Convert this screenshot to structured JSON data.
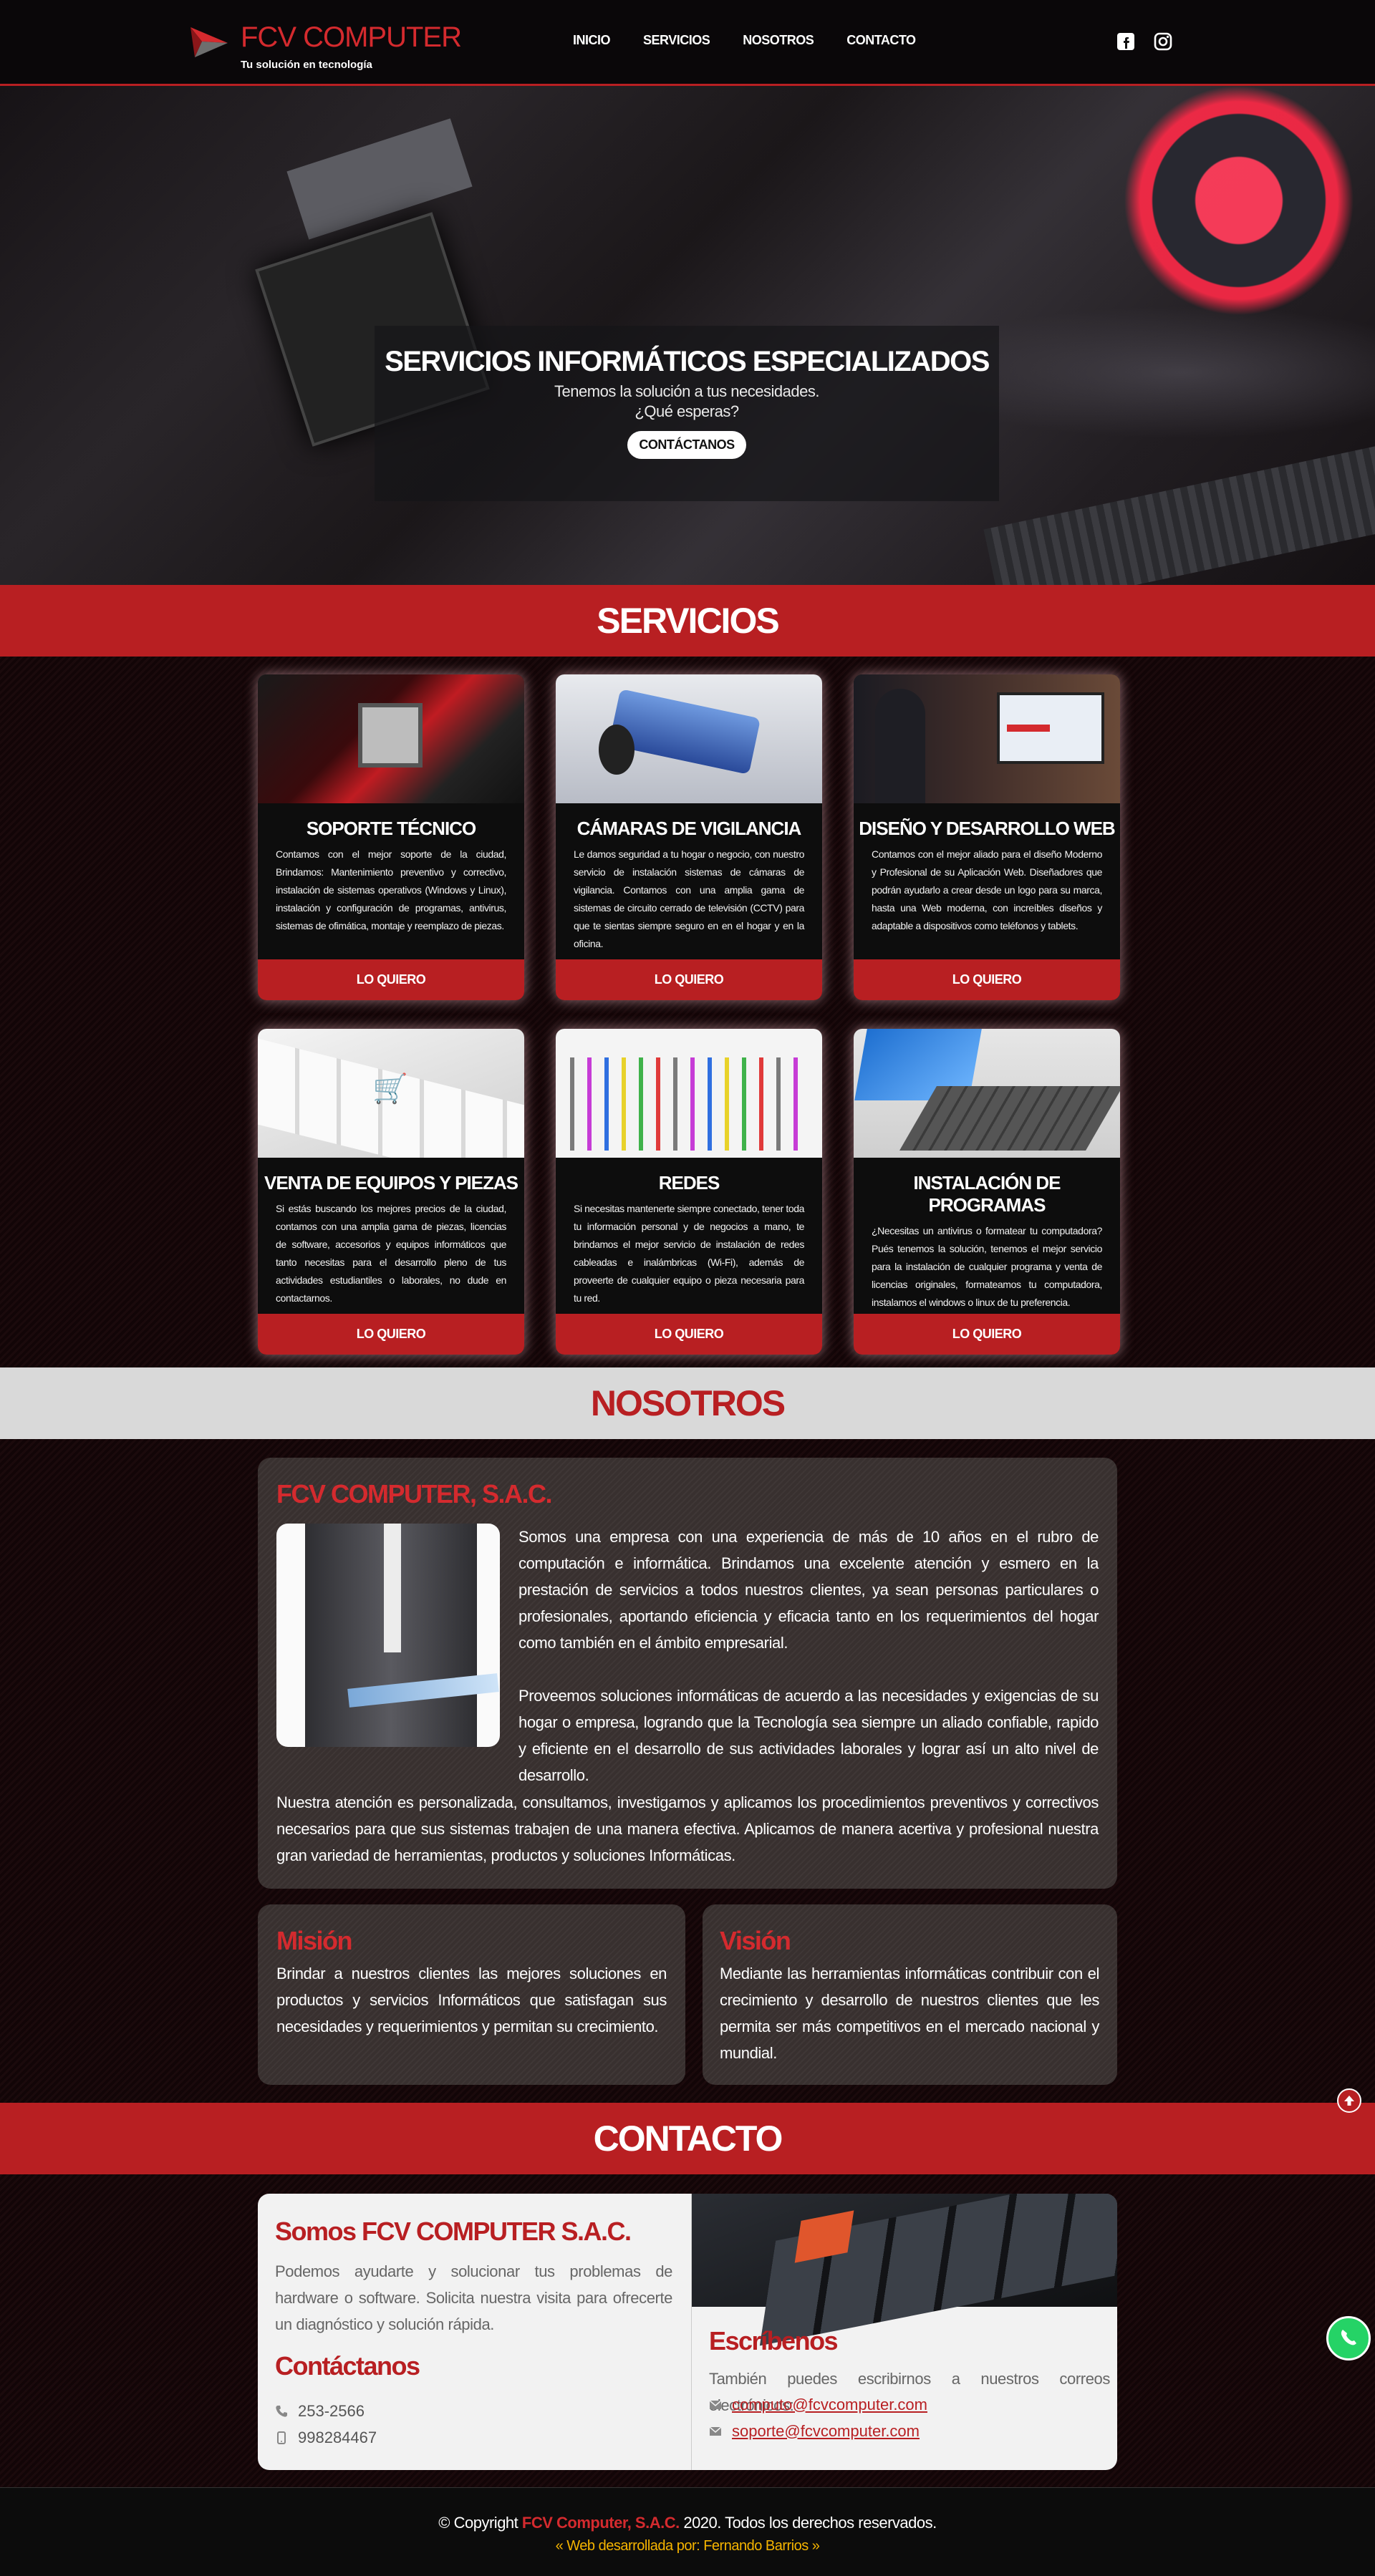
{
  "header": {
    "brand": "FCV COMPUTER",
    "tagline": "Tu solución en tecnología",
    "nav": [
      "INICIO",
      "SERVICIOS",
      "NOSOTROS",
      "CONTACTO"
    ],
    "social_icons": [
      "facebook-icon",
      "instagram-icon"
    ]
  },
  "hero": {
    "title": "SERVICIOS INFORMÁTICOS ESPECIALIZADOS",
    "line1": "Tenemos la solución a tus necesidades.",
    "line2": "¿Qué esperas?",
    "cta": "CONTÁCTANOS"
  },
  "servicios": {
    "heading": "SERVICIOS",
    "cards": [
      {
        "title": "SOPORTE TÉCNICO",
        "text": "Contamos con el mejor soporte de la ciudad, Brindamos: Mantenimiento preventivo y correctivo, instalación de sistemas operativos (Windows y Linux), instalación y configuración de programas, antivirus, sistemas de ofimática, montaje y reemplazo de piezas.",
        "button": "LO QUIERO"
      },
      {
        "title": "CÁMARAS DE VIGILANCIA",
        "text": "Le damos seguridad a tu hogar o negocio, con nuestro servicio de instalación sistemas de cámaras de vigilancia. Contamos con una amplia gama de sistemas de circuito cerrado de televisión (CCTV) para que te sientas siempre seguro en en el hogar y en la oficina.",
        "button": "LO QUIERO"
      },
      {
        "title": "DISEÑO Y DESARROLLO WEB",
        "text": "Contamos con el mejor aliado para el diseño Moderno y Profesional de su Aplicación Web. Diseñadores que podrán ayudarlo a crear desde un logo para su marca, hasta una Web moderna, con increíbles diseños y adaptable a dispositivos como teléfonos y tablets.",
        "button": "LO QUIERO"
      },
      {
        "title": "VENTA DE EQUIPOS Y PIEZAS",
        "text": "Si estás buscando los mejores precios de la ciudad, contamos con una amplia gama de piezas, licencias de software, accesorios y equipos informáticos que tanto necesitas para el desarrollo pleno de tus actividades estudiantiles o laborales, no dude en contactarnos.",
        "button": "LO QUIERO"
      },
      {
        "title": "REDES",
        "text": "Si necesitas mantenerte siempre conectado, tener toda tu información personal y de negocios a mano, te brindamos el mejor servicio de instalación de redes cableadas e inalámbricas (Wi-Fi), además de proveerte de cualquier equipo o pieza necesaria para tu red.",
        "button": "LO QUIERO"
      },
      {
        "title": "INSTALACIÓN DE PROGRAMAS",
        "text": "¿Necesitas un antivirus o formatear tu computadora? Pués tenemos la solución, tenemos el mejor servicio para la instalación de cualquier programa y venta de licencias originales, formateamos tu computadora, instalamos el windows o linux de tu preferencia.",
        "button": "LO QUIERO"
      }
    ]
  },
  "nosotros": {
    "heading": "NOSOTROS",
    "company": "FCV COMPUTER, S.A.C.",
    "p1": "Somos una empresa con una experiencia de más de 10 años en el rubro de computación e informática. Brindamos una excelente atención y esmero en la prestación de servicios a todos nuestros clientes, ya sean personas particulares o profesionales, aportando eficiencia y eficacia tanto en los requerimientos del hogar como también en el ámbito empresarial.",
    "p2": "Proveemos soluciones informáticas de acuerdo a las necesidades y exigencias de su hogar o empresa, logrando que la Tecnología sea siempre un aliado confiable, rapido y eficiente en el desarrollo de sus actividades laborales y lograr así un alto nivel de desarrollo.",
    "p3": "Nuestra atención es personalizada, consultamos, investigamos y aplicamos los procedimientos preventivos y correctivos necesarios para que sus sistemas trabajen de una manera efectiva. Aplicamos de manera acertiva y profesional nuestra gran variedad de herramientas, productos y soluciones Informáticas.",
    "mision_title": "Misión",
    "mision": "Brindar a nuestros clientes las mejores soluciones en productos y servicios Informáticos que satisfagan sus necesidades y requerimientos y permitan su crecimiento.",
    "vision_title": "Visión",
    "vision": "Mediante las herramientas informáticas contribuir con el crecimiento y desarrollo de nuestros clientes que les permita ser más competitivos en el mercado nacional y mundial."
  },
  "contacto": {
    "heading": "CONTACTO",
    "left_title": "Somos FCV COMPUTER S.A.C.",
    "left_text": "Podemos ayudarte y solucionar tus problemas de hardware o software. Solicita nuestra visita para ofrecerte un diagnóstico y solución rápida.",
    "contact_title": "Contáctanos",
    "phone": "253-2566",
    "mobile": "998284467",
    "right_title": "Escríbenos",
    "right_text": "También puedes escribirnos a nuestros correos electrónicos:",
    "email1": "computo@fcvcomputer.com",
    "email2": "soporte@fcvcomputer.com"
  },
  "footer": {
    "copyright_prefix": "Copyright",
    "company": "FCV Computer, S.A.C.",
    "copyright_suffix": "2020. Todos los derechos reservados.",
    "credit": "Web desarrollada por: Fernando Barrios"
  },
  "colors": {
    "accent": "#b81f22",
    "footer_credit": "#f5b400",
    "whatsapp": "#25d366"
  }
}
